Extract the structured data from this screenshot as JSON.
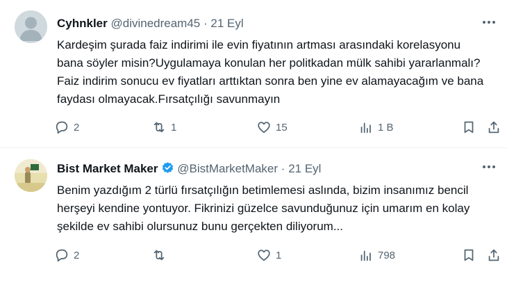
{
  "tweets": [
    {
      "name": "Cyhnkler",
      "handle": "@divinedream45",
      "separator": "·",
      "date": "21 Eyl",
      "text": "Kardeşim şurada faiz indirimi ile evin fiyatının artması arasındaki korelasyonu bana söyler misin?Uygulamaya konulan her politkadan mülk sahibi yararlanmalı?Faiz indirim sonucu ev fiyatları arttıktan sonra ben yine ev alamayacağım ve bana faydası olmayacak.Fırsatçılığı savunmayın",
      "replies": "2",
      "retweets": "1",
      "likes": "15",
      "views": "1 B",
      "verified": false
    },
    {
      "name": "Bist Market Maker",
      "handle": "@BistMarketMaker",
      "separator": "·",
      "date": "21 Eyl",
      "text": "Benim yazdığım 2 türlü fırsatçılığın betimlemesi aslında, bizim insanımız bencil herşeyi kendine yontuyor. Fikrinizi güzelce savunduğunuz için umarım en kolay şekilde ev sahibi olursunuz bunu gerçekten diliyorum...",
      "replies": "2",
      "retweets": "",
      "likes": "1",
      "views": "798",
      "verified": true
    }
  ],
  "colors": {
    "text": "#0f1419",
    "muted": "#536471",
    "verified": "#1d9bf0",
    "divider": "#eff3f4"
  },
  "icons": [
    "reply-icon",
    "retweet-icon",
    "like-icon",
    "views-icon",
    "bookmark-icon",
    "share-icon",
    "more-icon",
    "verified-badge-icon",
    "default-avatar-icon"
  ]
}
